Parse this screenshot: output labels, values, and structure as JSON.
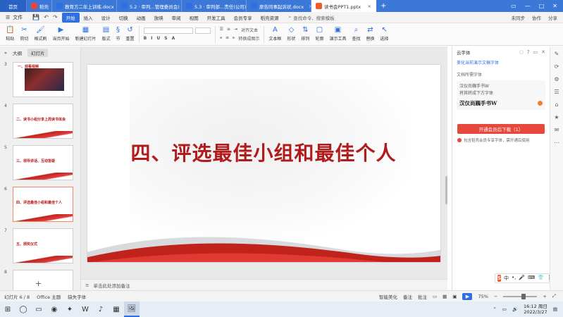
{
  "tabs": [
    {
      "label": "首页",
      "kind": "home"
    },
    {
      "label": "稻壳",
      "color": "#e8473b"
    },
    {
      "label": "教育方二年上训练.docx",
      "color": "#2f6fe0"
    },
    {
      "label": "5.2 · 审判...管理委员会)",
      "color": "#2f6fe0"
    },
    {
      "label": "5.3 · 审判部...责任(公司)",
      "color": "#2f6fe0"
    },
    {
      "label": "原告同事起诉状.docx",
      "color": "#2f6fe0"
    },
    {
      "label": "读书会PPT1.pptx",
      "color": "#f05a28",
      "active": true
    }
  ],
  "window_controls": [
    "▭",
    "—",
    "□",
    "✕"
  ],
  "menubar": {
    "file": "文件",
    "items": [
      "开始",
      "插入",
      "设计",
      "切换",
      "动画",
      "放映",
      "审阅",
      "视图",
      "开发工具",
      "会员专享",
      "稻壳资源"
    ],
    "active": "开始",
    "search": "查找命令、搜索模板",
    "right": [
      "未同步",
      "协作",
      "分享"
    ]
  },
  "ribbon": {
    "groups": [
      {
        "label": "粘贴",
        "glyph": "📋"
      },
      {
        "label": "剪切",
        "glyph": "✂"
      },
      {
        "label": "格式刷",
        "glyph": "🖌"
      },
      {
        "label": "当页开始",
        "glyph": "▶"
      },
      {
        "label": "新建幻灯片",
        "glyph": "▦"
      },
      {
        "label": "版式",
        "glyph": "▤"
      },
      {
        "label": "节",
        "glyph": "§"
      },
      {
        "label": "重置",
        "glyph": "↺"
      }
    ],
    "text_tools": [
      "B",
      "I",
      "U",
      "S",
      "A"
    ],
    "right_groups": [
      {
        "label": "文本框",
        "glyph": "A"
      },
      {
        "label": "形状",
        "glyph": "◇"
      },
      {
        "label": "排列",
        "glyph": "⇅"
      },
      {
        "label": "轮廓",
        "glyph": "▢"
      },
      {
        "label": "演示工具",
        "glyph": "▣"
      },
      {
        "label": "查找",
        "glyph": "⌕"
      },
      {
        "label": "替换",
        "glyph": "⇄"
      },
      {
        "label": "选择",
        "glyph": "↖"
      }
    ],
    "align_label": "对齐文本",
    "convert_label": "转换成图示"
  },
  "left_panel": {
    "tabs": [
      "大纲",
      "幻灯片"
    ],
    "active_tab": "幻灯片",
    "slides": [
      {
        "num": "3",
        "title": "一、观看视频",
        "kind": "photo"
      },
      {
        "num": "4",
        "title": "二、读书小组分享上周读书体会",
        "kind": "text"
      },
      {
        "num": "5",
        "title": "三、领导讲话、互动答疑",
        "kind": "text"
      },
      {
        "num": "6",
        "title": "四、评选最佳小组和最佳个人",
        "kind": "text",
        "active": true
      },
      {
        "num": "7",
        "title": "五、颁奖仪式",
        "kind": "text"
      },
      {
        "num": "8",
        "title": "",
        "kind": "text"
      }
    ],
    "add": "+"
  },
  "slide": {
    "title": "四、评选最佳小组和最佳个人"
  },
  "notes_placeholder": "单击此处添加备注",
  "right_panel": {
    "title": "云字体",
    "link": "美化当前演示文稿字体",
    "section": "文档所需字体",
    "fonts": [
      {
        "name": "汉仪尚巍手书W"
      },
      {
        "name": "将其转成下方字体"
      }
    ],
    "sample": "汉仪尚巍手书W",
    "download": "开通会员后下载（1）",
    "note": "包含稻壳会员专享字体，需开通后使用"
  },
  "sidebar_icons": [
    "✎",
    "⟳",
    "⚙",
    "☰",
    "⌂",
    "★",
    "✉",
    "⋯"
  ],
  "ime": {
    "mark": "S",
    "items": [
      "中",
      "•,",
      "🎤",
      "⌨",
      "👕",
      "⋮"
    ]
  },
  "statusbar": {
    "slide_info": "幻灯片 6 / 8",
    "theme": "Office 主题",
    "missing_font": "缺失字体",
    "beautify": "智能美化",
    "notes": "备注",
    "comments": "批注",
    "zoom": "75%",
    "zoom_level": 0.62
  },
  "taskbar": {
    "icons": [
      "⊞",
      "◯",
      "▭",
      "◉",
      "✦",
      "W",
      "♪",
      "▦",
      "🖼"
    ],
    "time": "16:12 周日",
    "date": "2022/3/27"
  }
}
